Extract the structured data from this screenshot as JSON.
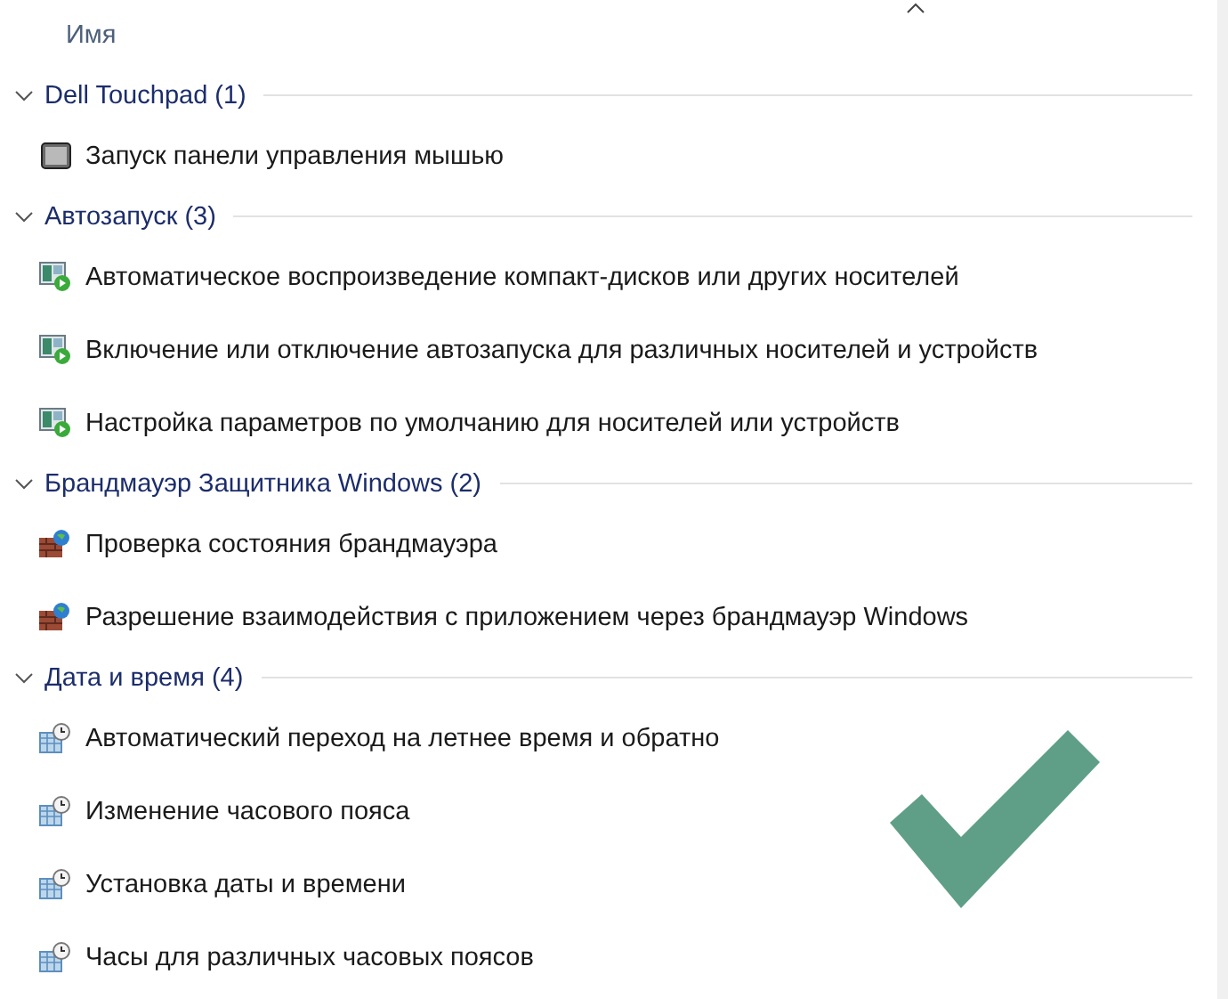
{
  "column_header": {
    "label": "Имя",
    "sort_ascending": true
  },
  "groups": [
    {
      "title": "Dell Touchpad (1)",
      "expanded": true,
      "items": [
        {
          "label": "Запуск панели управления мышью",
          "kind": "device"
        }
      ]
    },
    {
      "title": "Автозапуск (3)",
      "expanded": true,
      "items": [
        {
          "label": "Автоматическое воспроизведение компакт-дисков или других носителей",
          "kind": "autoplay"
        },
        {
          "label": "Включение или отключение автозапуска для различных носителей и устройств",
          "kind": "autoplay"
        },
        {
          "label": "Настройка параметров по умолчанию для носителей или устройств",
          "kind": "autoplay"
        }
      ]
    },
    {
      "title": "Брандмауэр Защитника Windows (2)",
      "expanded": true,
      "items": [
        {
          "label": "Проверка состояния брандмауэра",
          "kind": "firewall"
        },
        {
          "label": "Разрешение взаимодействия с приложением через брандмауэр Windows",
          "kind": "firewall"
        }
      ]
    },
    {
      "title": "Дата и время (4)",
      "expanded": true,
      "items": [
        {
          "label": "Автоматический переход на летнее время и обратно",
          "kind": "clock"
        },
        {
          "label": "Изменение часового пояса",
          "kind": "clock"
        },
        {
          "label": "Установка даты и времени",
          "kind": "clock"
        },
        {
          "label": "Часы для различных часовых поясов",
          "kind": "clock"
        }
      ]
    }
  ]
}
